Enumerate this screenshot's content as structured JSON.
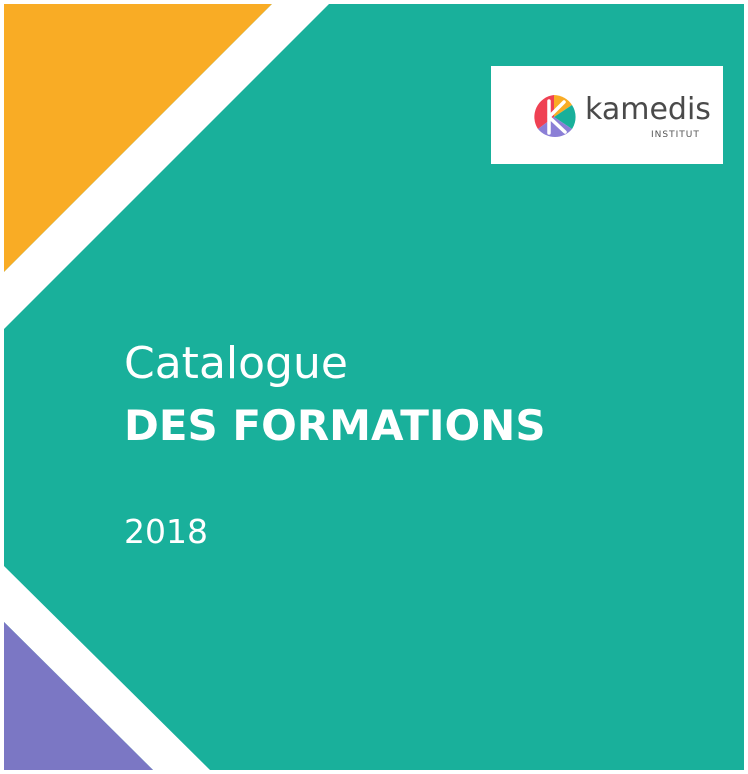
{
  "cover": {
    "title_light": "Catalogue",
    "title_bold": "DES FORMATIONS",
    "year": "2018"
  },
  "logo": {
    "name": "kamedis",
    "subtitle": "INSTITUT",
    "icon": "kamedis-logo-icon"
  },
  "colors": {
    "background": "#19b09b",
    "orange": "#f9ac25",
    "purple": "#7b77c4",
    "stripe": "#ffffff",
    "logo_red": "#ef4153",
    "logo_teal": "#19b09b",
    "logo_orange": "#f9ac25",
    "logo_purple": "#8b7fd6"
  }
}
